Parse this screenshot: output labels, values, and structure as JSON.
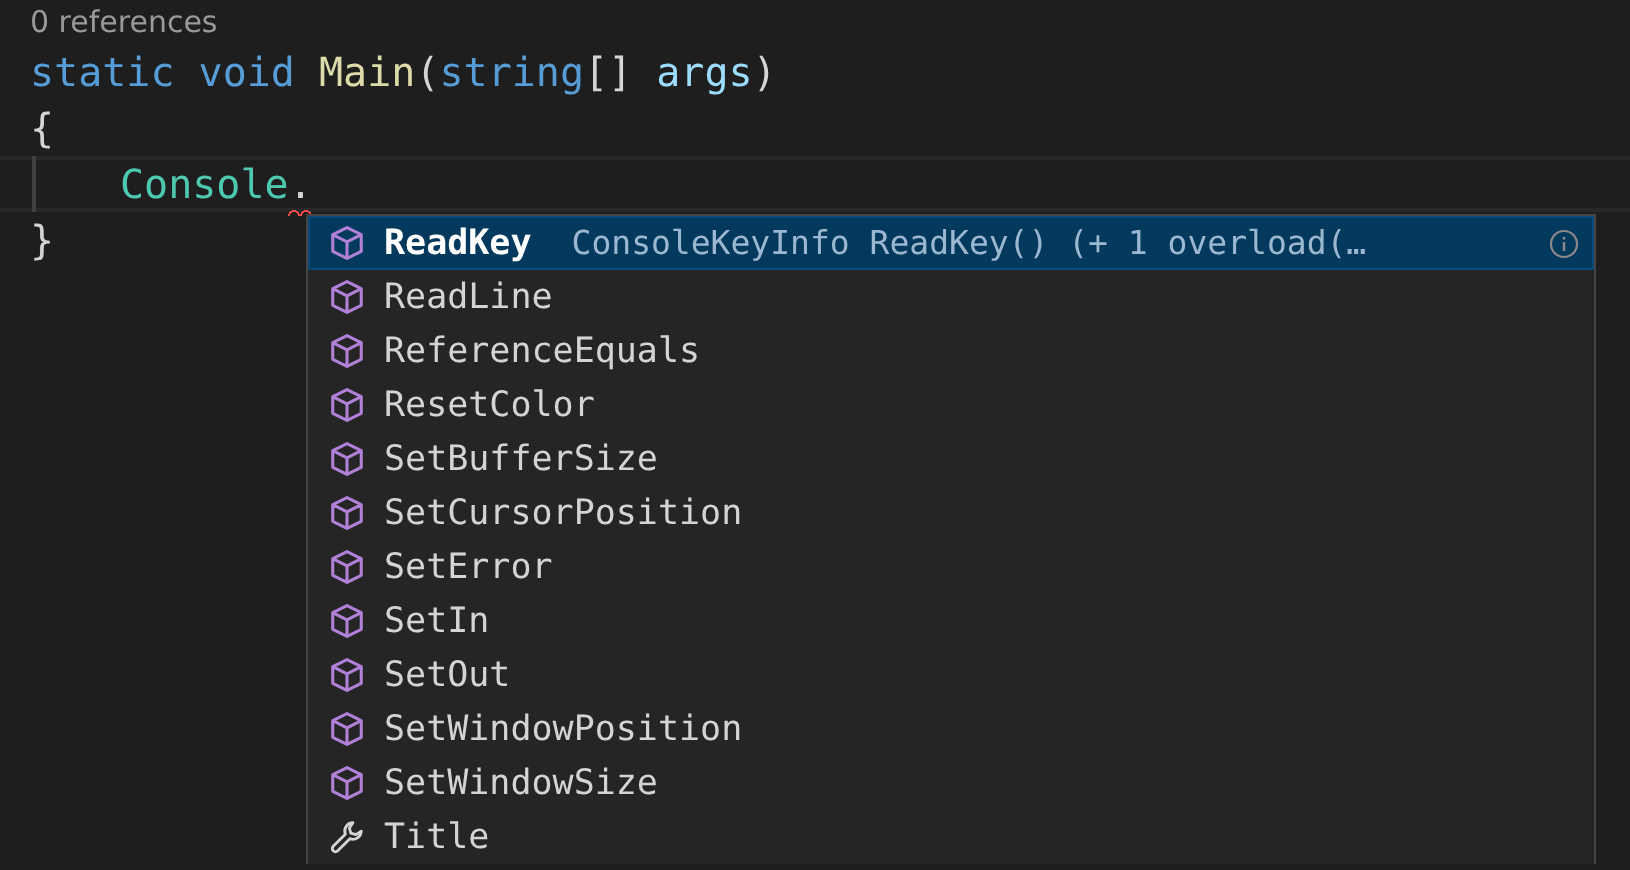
{
  "codelens": "0 references",
  "code_lines": [
    {
      "current": false,
      "tokens": [
        {
          "text": "static ",
          "kind": "keyword"
        },
        {
          "text": "void ",
          "kind": "keyword"
        },
        {
          "text": "Main",
          "kind": "function"
        },
        {
          "text": "(",
          "kind": "plain"
        },
        {
          "text": "string",
          "kind": "keyword"
        },
        {
          "text": "[] ",
          "kind": "plain"
        },
        {
          "text": "args",
          "kind": "parameter"
        },
        {
          "text": ")",
          "kind": "plain"
        }
      ]
    },
    {
      "current": false,
      "tokens": [
        {
          "text": "{",
          "kind": "plain"
        }
      ],
      "children": [
        {
          "current": true,
          "tokens": [
            {
              "text": "Console",
              "kind": "type"
            },
            {
              "text": ".",
              "kind": "plain",
              "error": true
            }
          ]
        }
      ]
    },
    {
      "current": false,
      "tokens": [
        {
          "text": "}",
          "kind": "plain"
        }
      ]
    }
  ],
  "suggestions": [
    {
      "label": "ReadKey",
      "kind": "method",
      "selected": true,
      "detail": "ConsoleKeyInfo ReadKey() (+ 1 overload(…"
    },
    {
      "label": "ReadLine",
      "kind": "method",
      "selected": false
    },
    {
      "label": "ReferenceEquals",
      "kind": "method",
      "selected": false
    },
    {
      "label": "ResetColor",
      "kind": "method",
      "selected": false
    },
    {
      "label": "SetBufferSize",
      "kind": "method",
      "selected": false
    },
    {
      "label": "SetCursorPosition",
      "kind": "method",
      "selected": false
    },
    {
      "label": "SetError",
      "kind": "method",
      "selected": false
    },
    {
      "label": "SetIn",
      "kind": "method",
      "selected": false
    },
    {
      "label": "SetOut",
      "kind": "method",
      "selected": false
    },
    {
      "label": "SetWindowPosition",
      "kind": "method",
      "selected": false
    },
    {
      "label": "SetWindowSize",
      "kind": "method",
      "selected": false
    },
    {
      "label": "Title",
      "kind": "property",
      "selected": false
    }
  ]
}
